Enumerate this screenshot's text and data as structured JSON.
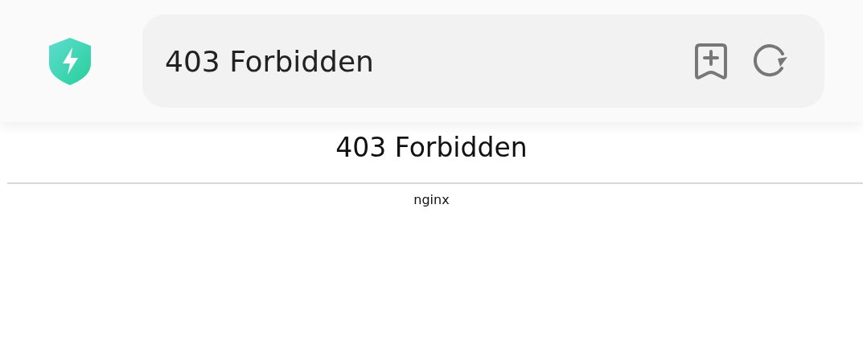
{
  "address_bar": {
    "value": "403 Forbidden"
  },
  "page": {
    "heading": "403 Forbidden",
    "footer": "nginx"
  }
}
